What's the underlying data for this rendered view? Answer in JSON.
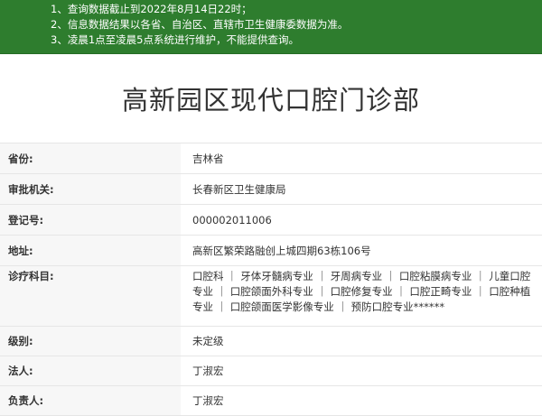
{
  "notice": {
    "lines": [
      "1、查询数据截止到2022年8月14日22时；",
      "2、信息数据结果以各省、自治区、直辖市卫生健康委数据为准。",
      "3、凌晨1点至凌晨5点系统进行维护，不能提供查询。"
    ]
  },
  "page": {
    "title": "高新园区现代口腔门诊部"
  },
  "fields": [
    {
      "label": "省份:",
      "value": "吉林省"
    },
    {
      "label": "审批机关:",
      "value": "长春新区卫生健康局"
    },
    {
      "label": "登记号:",
      "value": "000002011006"
    },
    {
      "label": "地址:",
      "value": "高新区繁荣路融创上城四期63栋106号"
    },
    {
      "label": "诊疗科目:",
      "value": "口腔科 ｜ 牙体牙髓病专业 ｜ 牙周病专业 ｜ 口腔粘膜病专业 ｜ 儿童口腔专业 ｜ 口腔颌面外科专业 ｜ 口腔修复专业 ｜ 口腔正畸专业 ｜ 口腔种植专业 ｜ 口腔颌面医学影像专业 ｜ 预防口腔专业******"
    },
    {
      "label": "级别:",
      "value": "未定级"
    },
    {
      "label": "法人:",
      "value": "丁淑宏"
    },
    {
      "label": "负责人:",
      "value": "丁淑宏"
    }
  ]
}
